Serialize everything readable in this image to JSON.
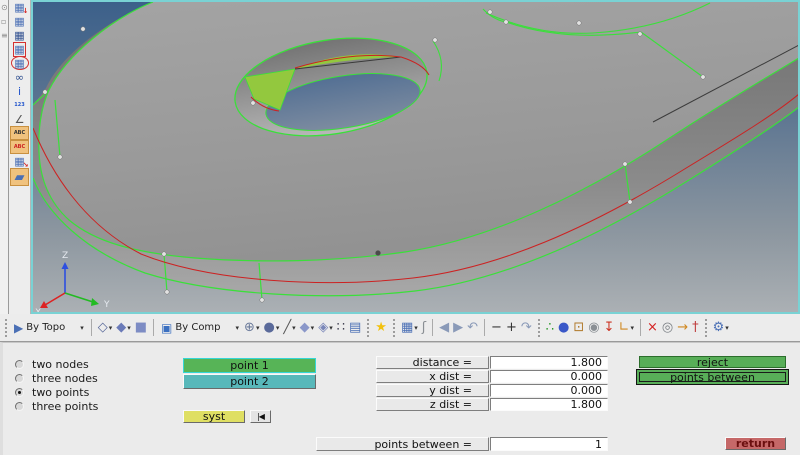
{
  "colors": {
    "viewport_border": "#79d2d4",
    "active_orange": "#f0c27e",
    "point1_bg": "#57b457",
    "point1_border": "#35d6d6",
    "point2_bg": "#58b8ba",
    "syst_bg": "#dfdf63",
    "reject_bg": "#58ae58",
    "return_bg": "#c56868",
    "return_text": "#6b0f0f",
    "edge_green": "#3ae03a",
    "curve_red": "#cc2222"
  },
  "edge_strip": {
    "icons": [
      {
        "name": "partial-search-icon",
        "glyph": "⊙"
      },
      {
        "name": "partial-panel-icon",
        "glyph": "▫"
      },
      {
        "name": "partial-list-icon",
        "glyph": "≡"
      }
    ]
  },
  "left_toolbar": {
    "items": [
      {
        "name": "mesh-update-icon",
        "glyph": "▦",
        "color": "#4a6fb5",
        "badge": "↓",
        "badgeColor": "#d42020"
      },
      {
        "name": "mesh-view-icon",
        "glyph": "▦",
        "color": "#4a6fb5"
      },
      {
        "name": "mesh-solid-icon",
        "glyph": "▦",
        "color": "#2f4f8f"
      },
      {
        "name": "mesh-region-icon",
        "glyph": "▦",
        "color": "#4a6fb5",
        "frame": "square"
      },
      {
        "name": "mesh-sphere-region-icon",
        "glyph": "▦",
        "color": "#4a6fb5",
        "frame": "circle"
      },
      {
        "name": "binoculars-icon",
        "glyph": "∞",
        "color": "#2f4f8f"
      },
      {
        "name": "info-icon",
        "glyph": "i",
        "color": "#2255cc"
      },
      {
        "name": "count-123-icon",
        "text": "123",
        "color": "#2255cc"
      },
      {
        "name": "measure-icon",
        "glyph": "∠",
        "color": "#555"
      },
      {
        "name": "label-abc-icon",
        "text": "ABC",
        "color": "#333",
        "active": true
      },
      {
        "name": "label-abc-red-icon",
        "text": "ABC",
        "color": "#cc2020",
        "active": true
      },
      {
        "name": "replace-node-icon",
        "glyph": "▦",
        "color": "#4a6fb5",
        "badge": "↘",
        "badgeColor": "#d42020"
      },
      {
        "name": "plane-icon",
        "glyph": "▰",
        "color": "#4a6fb5",
        "active": true,
        "tall": true
      }
    ]
  },
  "viewport": {
    "axis_labels": {
      "x": "X",
      "y": "Y",
      "z": "Z"
    }
  },
  "bottom_toolbar": {
    "items": [
      {
        "t": "dsep"
      },
      {
        "t": "group",
        "name": "display-by-topo",
        "icon": "by-topo-icon",
        "glyph": "▶",
        "color": "#4a6fb5",
        "label": "By Topo",
        "caret": true
      },
      {
        "t": "sep"
      },
      {
        "t": "icon",
        "name": "wireframe-mode-icon",
        "glyph": "◇",
        "color": "#5a6a9a",
        "caret": true
      },
      {
        "t": "icon",
        "name": "hidden-line-mode-icon",
        "glyph": "◆",
        "color": "#6a7ab8",
        "caret": true
      },
      {
        "t": "icon",
        "name": "shaded-mode-icon",
        "glyph": "■",
        "color": "#7d8cc4",
        "caret": false
      },
      {
        "t": "sep"
      },
      {
        "t": "group",
        "name": "display-by-comp",
        "icon": "by-comp-icon",
        "glyph": "▣",
        "color": "#3a6fc0",
        "label": "By Comp",
        "caret": true
      },
      {
        "t": "icon",
        "name": "wire-sphere-icon",
        "glyph": "⊕",
        "color": "#6a7a9a",
        "caret": true
      },
      {
        "t": "icon",
        "name": "solid-sphere-icon",
        "glyph": "●",
        "color": "#5a6a9a",
        "caret": true
      },
      {
        "t": "icon",
        "name": "line-display-icon",
        "glyph": "╱",
        "color": "#555",
        "caret": true
      },
      {
        "t": "icon",
        "name": "diamond-display-icon",
        "glyph": "◆",
        "color": "#8a97c9",
        "caret": true
      },
      {
        "t": "icon",
        "name": "facet-display-icon",
        "glyph": "◈",
        "color": "#7a87b9",
        "caret": true
      },
      {
        "t": "icon",
        "name": "points-display-icon",
        "glyph": "∷",
        "color": "#445",
        "caret": false
      },
      {
        "t": "icon",
        "name": "monitor-icon",
        "glyph": "▤",
        "color": "#4a6fb5",
        "caret": false
      },
      {
        "t": "dsep"
      },
      {
        "t": "icon",
        "name": "favorites-star-icon",
        "glyph": "★",
        "color": "#f2c10e",
        "caret": false
      },
      {
        "t": "dsep"
      },
      {
        "t": "icon",
        "name": "windows-layout-icon",
        "glyph": "▦",
        "color": "#4a6fb5",
        "caret": true
      },
      {
        "t": "icon",
        "name": "wrench-icon",
        "glyph": "ʃ",
        "color": "#8a8f94",
        "caret": false
      },
      {
        "t": "sep"
      },
      {
        "t": "icon",
        "name": "prev-view-icon",
        "glyph": "◀",
        "color": "#8a9ab8",
        "caret": false
      },
      {
        "t": "icon",
        "name": "next-view-icon",
        "glyph": "▶",
        "color": "#8a9ab8",
        "caret": false
      },
      {
        "t": "icon",
        "name": "undo-view-icon",
        "glyph": "↶",
        "color": "#8a9ab8",
        "caret": false
      },
      {
        "t": "sep"
      },
      {
        "t": "icon",
        "name": "zoom-out-icon",
        "glyph": "−",
        "color": "#333",
        "caret": false
      },
      {
        "t": "icon",
        "name": "zoom-in-icon",
        "glyph": "+",
        "color": "#333",
        "caret": false
      },
      {
        "t": "icon",
        "name": "redo-view-icon",
        "glyph": "↷",
        "color": "#8a9ab8",
        "caret": false
      },
      {
        "t": "dsep"
      },
      {
        "t": "icon",
        "name": "colored-balls-icon",
        "glyph": "∴",
        "color": "#2a9a2a",
        "caret": false
      },
      {
        "t": "icon",
        "name": "blue-sphere-icon",
        "glyph": "●",
        "color": "#3a58c8",
        "caret": false
      },
      {
        "t": "icon",
        "name": "folder-contents-icon",
        "glyph": "⊡",
        "color": "#b07828",
        "caret": false
      },
      {
        "t": "icon",
        "name": "sphere-folder-icon",
        "glyph": "◉",
        "color": "#8a8f94",
        "caret": false
      },
      {
        "t": "icon",
        "name": "import-folder-icon",
        "glyph": "↧",
        "color": "#cc3322",
        "caret": false
      },
      {
        "t": "icon",
        "name": "curve-node-icon",
        "glyph": "∟",
        "color": "#d08820",
        "caret": true
      },
      {
        "t": "sep"
      },
      {
        "t": "icon",
        "name": "delete-icon",
        "glyph": "×",
        "color": "#d42020",
        "caret": false
      },
      {
        "t": "icon",
        "name": "gray-spheres-icon",
        "glyph": "◎",
        "color": "#7a7f84",
        "caret": false
      },
      {
        "t": "icon",
        "name": "export-folder-icon",
        "glyph": "→",
        "color": "#d08820",
        "caret": false
      },
      {
        "t": "icon",
        "name": "probe-icon",
        "glyph": "†",
        "color": "#c04040",
        "caret": false
      },
      {
        "t": "dsep"
      },
      {
        "t": "icon",
        "name": "settings-gear-icon",
        "glyph": "⚙",
        "color": "#4a6fb5",
        "caret": true
      }
    ]
  },
  "panel": {
    "radio_options": [
      {
        "label": "two nodes",
        "selected": false
      },
      {
        "label": "three nodes",
        "selected": false
      },
      {
        "label": "two points",
        "selected": true
      },
      {
        "label": "three points",
        "selected": false
      }
    ],
    "buttons": {
      "point1": "point 1",
      "point2": "point 2",
      "syst": "syst",
      "first_glyph": "|◀",
      "reject": "reject",
      "points_between": "points between",
      "return": "return"
    },
    "fields": [
      {
        "label": "distance =",
        "value": "1.800"
      },
      {
        "label": "x dist =",
        "value": "0.000"
      },
      {
        "label": "y dist =",
        "value": "0.000"
      },
      {
        "label": "z dist =",
        "value": "1.800"
      }
    ],
    "points_between_row": {
      "label": "points between =",
      "value": "1"
    }
  }
}
